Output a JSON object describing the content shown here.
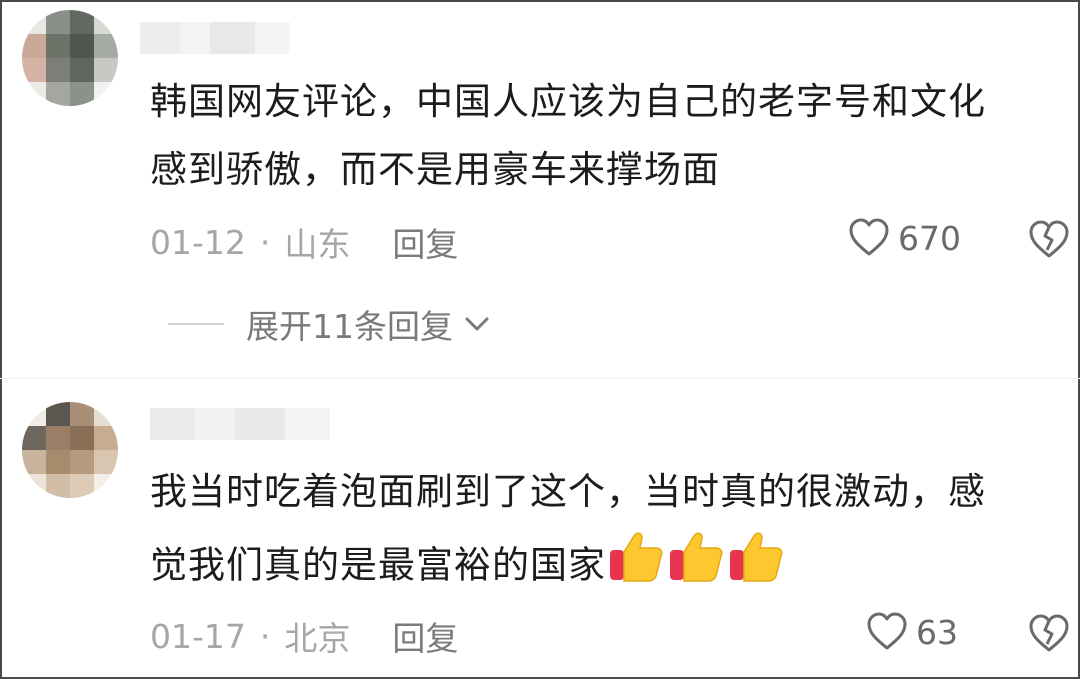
{
  "comments": [
    {
      "text_line1": "韩国网友评论，中国人应该为自己的老字号和文化",
      "text_line2": "感到骄傲，而不是用豪车来撑场面",
      "date": "01-12",
      "dot": "·",
      "location": "山东",
      "reply_label": "回复",
      "likes": "670",
      "expand_label": "展开11条回复"
    },
    {
      "text_line1": "我当时吃着泡面刷到了这个，当时真的很激动，感",
      "text_line2": "觉我们真的是最富裕的国家",
      "date": "01-17",
      "dot": "·",
      "location": "北京",
      "reply_label": "回复",
      "likes": "63"
    }
  ],
  "colors": {
    "text": "#1c1c1c",
    "meta": "#a6a6a6",
    "reply": "#7a7a7a",
    "heart": "#6a6a6a"
  },
  "icons": [
    "heart-icon",
    "broken-heart-icon",
    "chevron-down-icon",
    "thumbs-up-emoji"
  ]
}
